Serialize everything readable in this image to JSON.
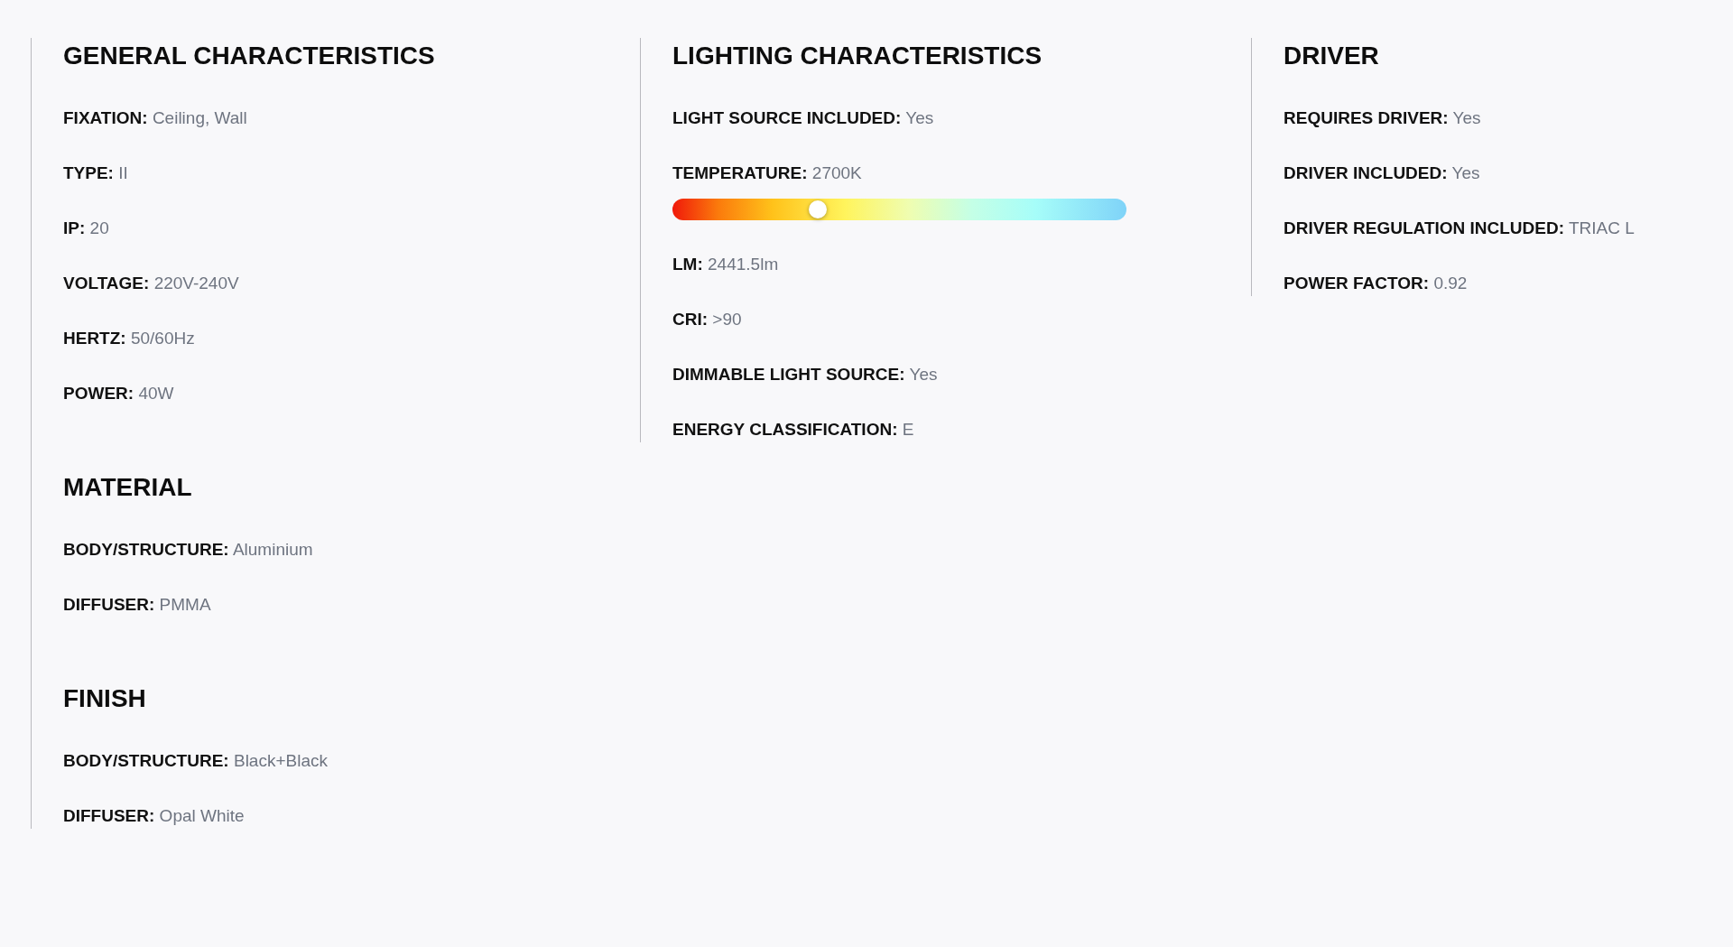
{
  "columns": [
    {
      "sections": [
        {
          "heading": "GENERAL CHARACTERISTICS",
          "items": [
            {
              "kind": "text",
              "label": "FIXATION:",
              "value": "Ceiling, Wall"
            },
            {
              "kind": "text",
              "label": "TYPE:",
              "value": "II"
            },
            {
              "kind": "text",
              "label": "IP:",
              "value": "20"
            },
            {
              "kind": "text",
              "label": "VOLTAGE:",
              "value": "220V-240V"
            },
            {
              "kind": "text",
              "label": "HERTZ:",
              "value": "50/60Hz"
            },
            {
              "kind": "text",
              "label": "POWER:",
              "value": "40W"
            }
          ]
        },
        {
          "heading": "MATERIAL",
          "items": [
            {
              "kind": "text",
              "label": "BODY/STRUCTURE:",
              "value": "Aluminium"
            },
            {
              "kind": "text",
              "label": "DIFFUSER:",
              "value": "PMMA"
            }
          ]
        },
        {
          "heading": "FINISH",
          "items": [
            {
              "kind": "text",
              "label": "BODY/STRUCTURE:",
              "value": "Black+Black"
            },
            {
              "kind": "text",
              "label": "DIFFUSER:",
              "value": "Opal White"
            }
          ]
        }
      ]
    },
    {
      "sections": [
        {
          "heading": "LIGHTING CHARACTERISTICS",
          "items": [
            {
              "kind": "text",
              "label": "LIGHT SOURCE INCLUDED:",
              "value": "Yes"
            },
            {
              "kind": "slider",
              "label": "TEMPERATURE:",
              "value": "2700K",
              "level": 0.32
            },
            {
              "kind": "text",
              "label": "LM:",
              "value": "2441.5lm"
            },
            {
              "kind": "text",
              "label": "CRI:",
              "value": ">90"
            },
            {
              "kind": "text",
              "label": "DIMMABLE LIGHT SOURCE:",
              "value": "Yes"
            },
            {
              "kind": "text",
              "label": "ENERGY CLASSIFICATION:",
              "value": "E"
            }
          ]
        }
      ]
    },
    {
      "sections": [
        {
          "heading": "DRIVER",
          "items": [
            {
              "kind": "text",
              "label": "REQUIRES DRIVER:",
              "value": "Yes"
            },
            {
              "kind": "text",
              "label": "DRIVER INCLUDED:",
              "value": "Yes"
            },
            {
              "kind": "text",
              "label": "DRIVER REGULATION INCLUDED:",
              "value": "TRIAC L"
            },
            {
              "kind": "text",
              "label": "POWER FACTOR:",
              "value": "0.92"
            }
          ]
        }
      ]
    }
  ]
}
